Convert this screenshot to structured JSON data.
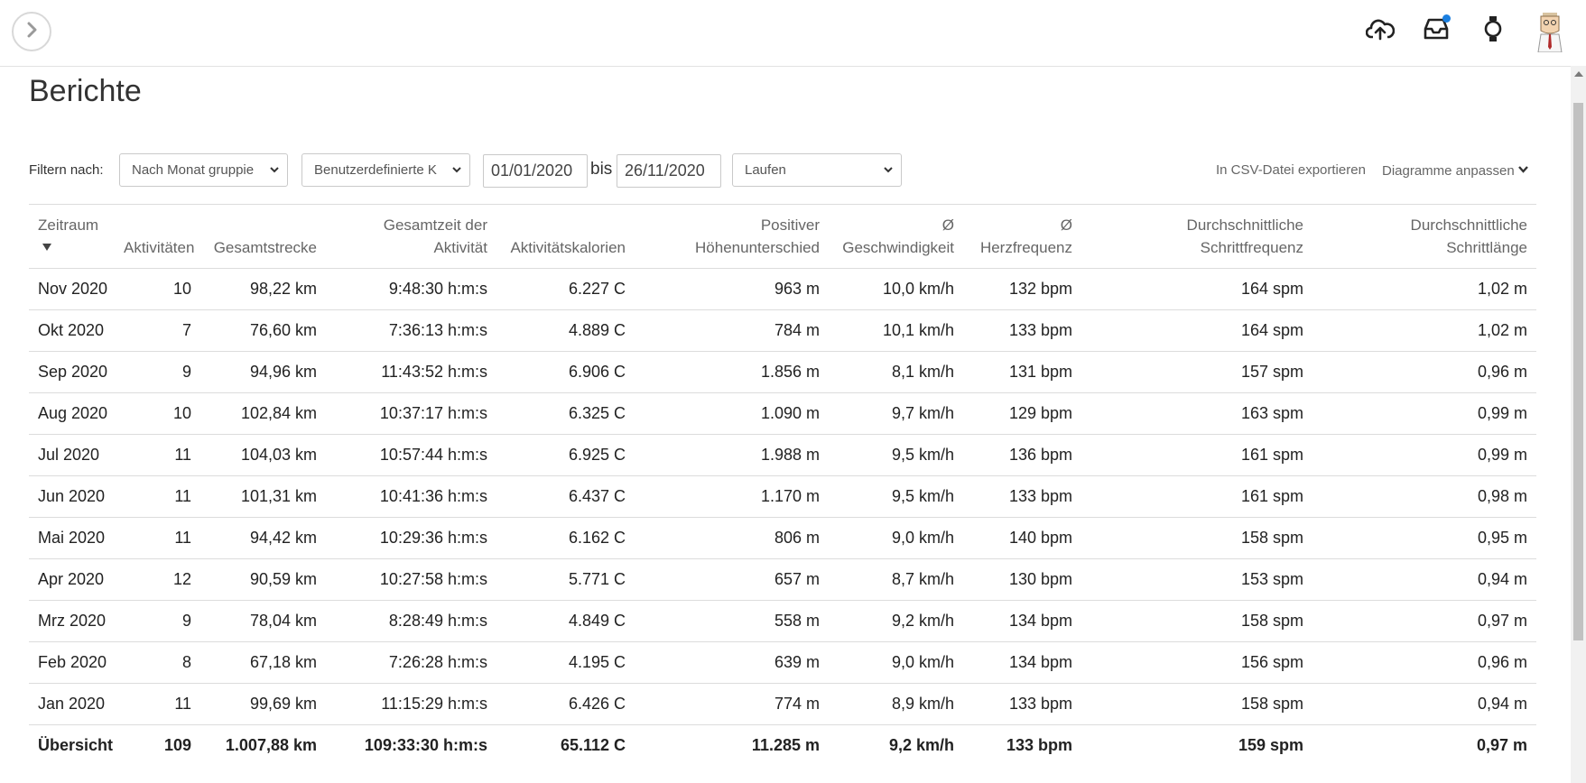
{
  "colors": {
    "notification_dot": "#1a7fe0",
    "accent_dark": "#222222"
  },
  "topbar": {
    "icons": [
      "chevron-right-icon",
      "cloud-upload-icon",
      "inbox-icon",
      "watch-icon",
      "avatar"
    ]
  },
  "page": {
    "title": "Berichte"
  },
  "filters": {
    "label": "Filtern nach:",
    "group_select": "Nach Monat gruppie",
    "range_select": "Benutzerdefinierte K",
    "date_from": "01/01/2020",
    "separator": "bis",
    "date_to": "26/11/2020",
    "activity_select": "Laufen",
    "export_link": "In CSV-Datei exportieren",
    "charts_link": "Diagramme anpassen"
  },
  "table": {
    "headers": [
      {
        "line1": "Zeitraum",
        "line2": ""
      },
      {
        "line1": "",
        "line2": "Aktivitäten"
      },
      {
        "line1": "",
        "line2": "Gesamtstrecke"
      },
      {
        "line1": "Gesamtzeit der",
        "line2": "Aktivität"
      },
      {
        "line1": "",
        "line2": "Aktivitätskalorien"
      },
      {
        "line1": "Positiver",
        "line2": "Höhenunterschied"
      },
      {
        "line1": "Ø",
        "line2": "Geschwindigkeit"
      },
      {
        "line1": "Ø",
        "line2": "Herzfrequenz"
      },
      {
        "line1": "Durchschnittliche",
        "line2": "Schrittfrequenz"
      },
      {
        "line1": "Durchschnittliche",
        "line2": "Schrittlänge"
      }
    ],
    "rows": [
      [
        "Nov 2020",
        "10",
        "98,22 km",
        "9:48:30 h:m:s",
        "6.227 C",
        "963 m",
        "10,0 km/h",
        "132 bpm",
        "164 spm",
        "1,02 m"
      ],
      [
        "Okt 2020",
        "7",
        "76,60 km",
        "7:36:13 h:m:s",
        "4.889 C",
        "784 m",
        "10,1 km/h",
        "133 bpm",
        "164 spm",
        "1,02 m"
      ],
      [
        "Sep 2020",
        "9",
        "94,96 km",
        "11:43:52 h:m:s",
        "6.906 C",
        "1.856 m",
        "8,1 km/h",
        "131 bpm",
        "157 spm",
        "0,96 m"
      ],
      [
        "Aug 2020",
        "10",
        "102,84 km",
        "10:37:17 h:m:s",
        "6.325 C",
        "1.090 m",
        "9,7 km/h",
        "129 bpm",
        "163 spm",
        "0,99 m"
      ],
      [
        "Jul 2020",
        "11",
        "104,03 km",
        "10:57:44 h:m:s",
        "6.925 C",
        "1.988 m",
        "9,5 km/h",
        "136 bpm",
        "161 spm",
        "0,99 m"
      ],
      [
        "Jun 2020",
        "11",
        "101,31 km",
        "10:41:36 h:m:s",
        "6.437 C",
        "1.170 m",
        "9,5 km/h",
        "133 bpm",
        "161 spm",
        "0,98 m"
      ],
      [
        "Mai 2020",
        "11",
        "94,42 km",
        "10:29:36 h:m:s",
        "6.162 C",
        "806 m",
        "9,0 km/h",
        "140 bpm",
        "158 spm",
        "0,95 m"
      ],
      [
        "Apr 2020",
        "12",
        "90,59 km",
        "10:27:58 h:m:s",
        "5.771 C",
        "657 m",
        "8,7 km/h",
        "130 bpm",
        "153 spm",
        "0,94 m"
      ],
      [
        "Mrz 2020",
        "9",
        "78,04 km",
        "8:28:49 h:m:s",
        "4.849 C",
        "558 m",
        "9,2 km/h",
        "134 bpm",
        "158 spm",
        "0,97 m"
      ],
      [
        "Feb 2020",
        "8",
        "67,18 km",
        "7:26:28 h:m:s",
        "4.195 C",
        "639 m",
        "9,0 km/h",
        "134 bpm",
        "156 spm",
        "0,96 m"
      ],
      [
        "Jan 2020",
        "11",
        "99,69 km",
        "11:15:29 h:m:s",
        "6.426 C",
        "774 m",
        "8,9 km/h",
        "133 bpm",
        "158 spm",
        "0,94 m"
      ]
    ],
    "summary": [
      "Übersicht",
      "109",
      "1.007,88 km",
      "109:33:30 h:m:s",
      "65.112 C",
      "11.285 m",
      "9,2 km/h",
      "133 bpm",
      "159 spm",
      "0,97 m"
    ]
  }
}
